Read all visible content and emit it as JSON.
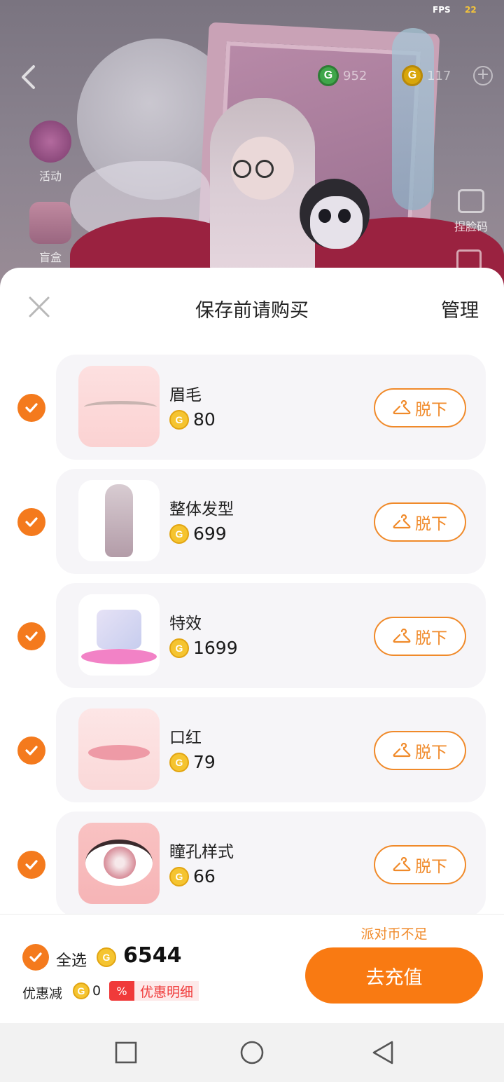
{
  "status": {
    "fps_label": "FPS",
    "fps_value": "22"
  },
  "game_hud": {
    "green_coin_value": "952",
    "gold_coin_value": "117",
    "side_entries": [
      {
        "label": "活动"
      },
      {
        "label": "盲盒"
      }
    ],
    "face_code_label": "捏脸码"
  },
  "sheet": {
    "title": "保存前请购买",
    "manage_label": "管理",
    "remove_label": "脱下",
    "items": [
      {
        "name": "眉毛",
        "price": "80",
        "checked": true
      },
      {
        "name": "整体发型",
        "price": "699",
        "checked": true
      },
      {
        "name": "特效",
        "price": "1699",
        "checked": true
      },
      {
        "name": "口红",
        "price": "79",
        "checked": true
      },
      {
        "name": "瞳孔样式",
        "price": "66",
        "checked": true
      }
    ]
  },
  "footer": {
    "select_all_label": "全选",
    "total_price": "6544",
    "discount_label": "优惠减",
    "discount_value": "0",
    "discount_pct_symbol": "%",
    "discount_detail_label": "优惠明细",
    "insufficient_text": "派对币不足",
    "recharge_label": "去充值"
  },
  "colors": {
    "accent": "#f97a12",
    "coin": "#f5c430",
    "discount_red": "#f03a3a"
  }
}
